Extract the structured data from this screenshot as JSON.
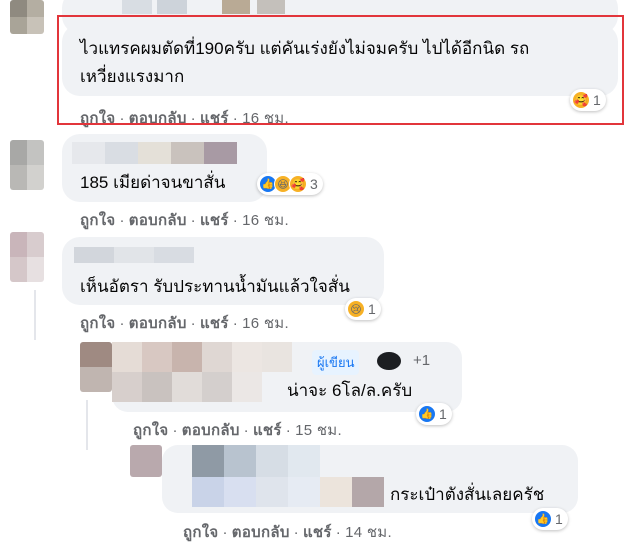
{
  "comments": [
    {
      "text_line1": "ไวแทรคผมตัดที่190ครับ แต่คันเร่งยังไม่จมครับ ไปได้อีกนิด รถ",
      "text_line2": "เหวี่ยงแรงมาก",
      "actions": {
        "like": "ถูกใจ",
        "reply": "ตอบกลับ",
        "share": "แชร์",
        "time": "16 ชม."
      },
      "reaction_count": "1",
      "reaction_icons": [
        "care-emoji-icon"
      ]
    },
    {
      "text": "185 เมียด่าจนขาสั่น",
      "actions": {
        "like": "ถูกใจ",
        "reply": "ตอบกลับ",
        "share": "แชร์",
        "time": "16 ชม."
      },
      "reaction_count": "3",
      "reaction_icons": [
        "like-icon",
        "haha-emoji-icon",
        "care-emoji-icon"
      ]
    },
    {
      "text": "เห็นอัตรา รับประทานน้ำมันแล้วใจสั่น",
      "actions": {
        "like": "ถูกใจ",
        "reply": "ตอบกลับ",
        "share": "แชร์",
        "time": "16 ชม."
      },
      "reaction_count": "1",
      "reaction_icons": [
        "sad-emoji-icon"
      ]
    },
    {
      "badge": "ผู้เขียน",
      "text": "น่าจะ 6โล/ล.ครับ",
      "actions": {
        "like": "ถูกใจ",
        "reply": "ตอบกลับ",
        "share": "แชร์",
        "time": "15 ชม."
      },
      "reaction_count": "1",
      "reaction_icons": [
        "like-icon"
      ],
      "extra_count": "+1"
    },
    {
      "text": "กระเป๋าตังสั่นเลยครัช",
      "actions": {
        "like": "ถูกใจ",
        "reply": "ตอบกลับ",
        "share": "แชร์",
        "time": "14 ชม."
      },
      "reaction_count": "1",
      "reaction_icons": [
        "like-icon"
      ]
    }
  ],
  "colors": {
    "bubble": "#f0f2f5",
    "meta": "#65676b",
    "highlight": "#e2353b",
    "like": "#1877f2",
    "emoji": "#f7b125"
  }
}
